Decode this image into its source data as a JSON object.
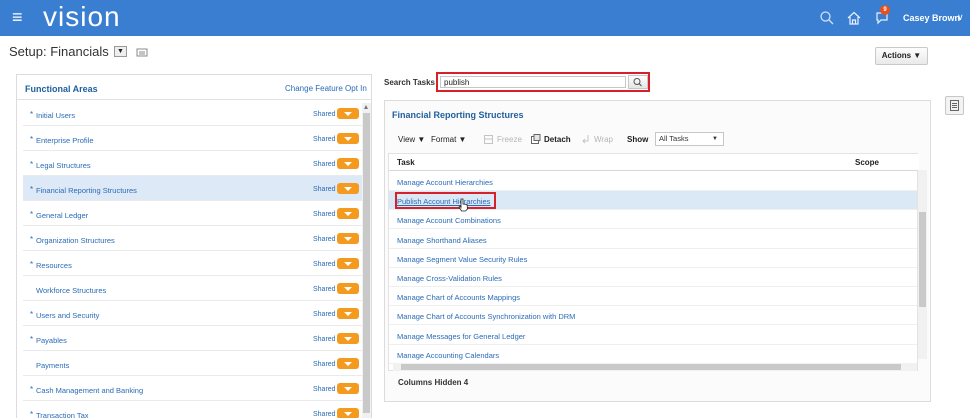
{
  "topbar": {
    "menu_glyph": "≡",
    "logo": "vision",
    "notification_count": "9",
    "user_name": "Casey Brown",
    "icons": [
      "menu-icon",
      "search-icon",
      "home-icon",
      "notifications-icon",
      "chevron-down-icon"
    ]
  },
  "header": {
    "title": "Setup: Financials",
    "actions_label": "Actions ▼"
  },
  "functional_areas": {
    "title": "Functional Areas",
    "change_link": "Change Feature Opt In",
    "items": [
      {
        "star": "*",
        "label": "Initial Users",
        "shared": "Shared"
      },
      {
        "star": "*",
        "label": "Enterprise Profile",
        "shared": "Shared"
      },
      {
        "star": "*",
        "label": "Legal Structures",
        "shared": "Shared"
      },
      {
        "star": "*",
        "label": "Financial Reporting Structures",
        "shared": "Shared"
      },
      {
        "star": "*",
        "label": "General Ledger",
        "shared": "Shared"
      },
      {
        "star": "*",
        "label": "Organization Structures",
        "shared": "Shared"
      },
      {
        "star": "*",
        "label": "Resources",
        "shared": "Shared"
      },
      {
        "star": "",
        "label": "Workforce Structures",
        "shared": "Shared"
      },
      {
        "star": "*",
        "label": "Users and Security",
        "shared": "Shared"
      },
      {
        "star": "*",
        "label": "Payables",
        "shared": "Shared"
      },
      {
        "star": "",
        "label": "Payments",
        "shared": "Shared"
      },
      {
        "star": "*",
        "label": "Cash Management and Banking",
        "shared": "Shared"
      },
      {
        "star": "*",
        "label": "Transaction Tax",
        "shared": "Shared"
      }
    ],
    "selected_index": 3
  },
  "search": {
    "label": "Search Tasks",
    "value": "publish"
  },
  "tasks_panel": {
    "title": "Financial Reporting Structures",
    "toolbar": {
      "view": "View ▼",
      "format": "Format ▼",
      "freeze": "Freeze",
      "detach": "Detach",
      "wrap": "Wrap",
      "show_label": "Show",
      "show_value": "All Tasks"
    },
    "columns": {
      "task": "Task",
      "scope": "Scope"
    },
    "rows": [
      "Manage Account Hierarchies",
      "Publish Account Hierarchies",
      "Manage Account Combinations",
      "Manage Shorthand Aliases",
      "Manage Segment Value Security Rules",
      "Manage Cross-Validation Rules",
      "Manage Chart of Accounts Mappings",
      "Manage Chart of Accounts Synchronization with DRM",
      "Manage Messages for General Ledger",
      "Manage Accounting Calendars"
    ],
    "selected_row": 1,
    "columns_hidden_label": "Columns Hidden",
    "columns_hidden_count": "4"
  },
  "colors": {
    "topbar": "#3a7ed2",
    "link": "#2a6bb6",
    "heading": "#1f5f9f",
    "tag": "#f39a1f",
    "highlight_border": "#d6202a",
    "selected_row": "#dbe8f6"
  }
}
